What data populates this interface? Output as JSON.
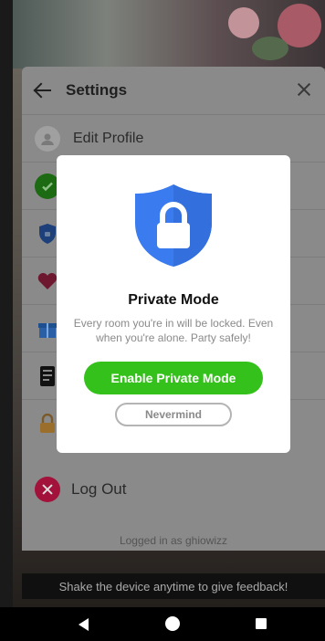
{
  "settings": {
    "title": "Settings",
    "items": [
      {
        "label": "Edit Profile",
        "icon": "avatar-icon"
      },
      {
        "label": "",
        "icon": "check-icon"
      },
      {
        "label": "",
        "icon": "shield-icon"
      },
      {
        "label": "",
        "icon": "heart-icon"
      },
      {
        "label": "",
        "icon": "gift-icon"
      },
      {
        "label": "",
        "icon": "document-icon"
      },
      {
        "label": "",
        "icon": "lock-icon"
      }
    ],
    "logout_label": "Log Out",
    "logged_in_text": "Logged in as ghiowizz"
  },
  "feedback": {
    "text": "Shake the device anytime to give feedback!"
  },
  "modal": {
    "title": "Private Mode",
    "body": "Every room you're in will be locked. Even when you're alone. Party safely!",
    "enable_label": "Enable Private Mode",
    "nevermind_label": "Nevermind",
    "icon": "shield-lock-icon"
  },
  "colors": {
    "accent_green": "#34c11b",
    "shield_blue": "#3a7bef",
    "logout_red": "#a2123a"
  }
}
